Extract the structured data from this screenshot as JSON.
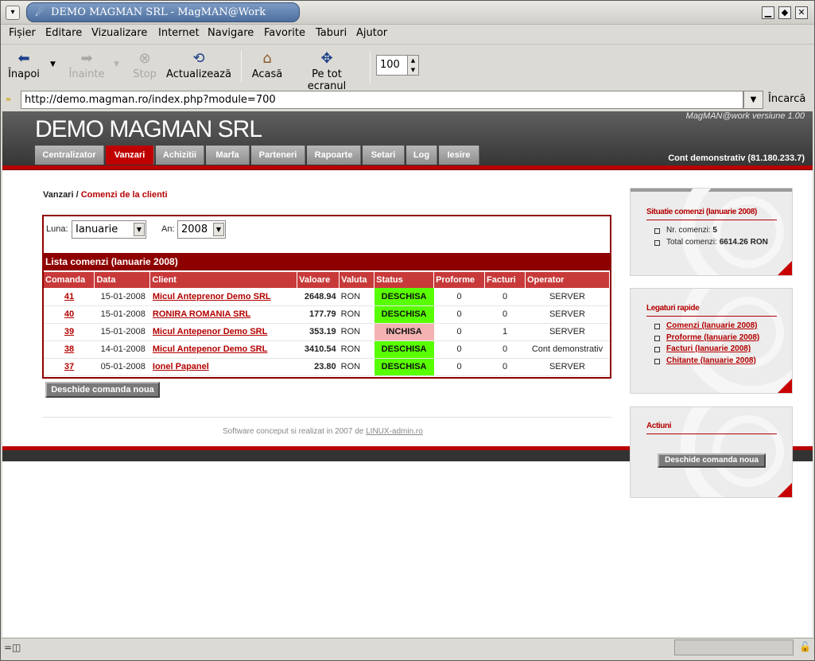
{
  "window": {
    "title": "DEMO MAGMAN SRL - MagMAN@Work",
    "controls": {
      "minimize": "▁",
      "maximize": "◆",
      "close": "✕"
    }
  },
  "menubar": [
    "Fișier",
    "Editare",
    "Vizualizare",
    "Internet",
    "Navigare",
    "Favorite",
    "Taburi",
    "Ajutor"
  ],
  "toolbar": {
    "back": "Înapoi",
    "forward": "Înainte",
    "stop": "Stop",
    "reload": "Actualizează",
    "home": "Acasă",
    "fullscreen": "Pe tot ecranul",
    "zoom": "100"
  },
  "address": {
    "url": "http://demo.magman.ro/index.php?module=700",
    "go": "Încarcă"
  },
  "site": {
    "title": "DEMO MAGMAN SRL",
    "version": "MagMAN@work versiune 1.00",
    "account": "Cont demonstrativ (81.180.233.7)",
    "nav": [
      {
        "label": "Centralizator",
        "active": false
      },
      {
        "label": "Vanzari",
        "active": true
      },
      {
        "label": "Achizitii",
        "active": false
      },
      {
        "label": "Marfa",
        "active": false
      },
      {
        "label": "Parteneri",
        "active": false
      },
      {
        "label": "Rapoarte",
        "active": false
      },
      {
        "label": "Setari",
        "active": false
      },
      {
        "label": "Log",
        "active": false
      },
      {
        "label": "Iesire",
        "active": false
      }
    ]
  },
  "breadcrumb": {
    "root": "Vanzari",
    "sep": " / ",
    "current": "Comenzi de la clienti"
  },
  "filters": {
    "month_label": "Luna:",
    "month_value": "Ianuarie",
    "year_label": "An:",
    "year_value": "2008"
  },
  "list": {
    "title": "Lista comenzi (Ianuarie 2008)",
    "columns": [
      "Comanda",
      "Data",
      "Client",
      "Valoare",
      "Valuta",
      "Status",
      "Proforme",
      "Facturi",
      "Operator"
    ],
    "rows": [
      {
        "order": "41",
        "date": "15-01-2008",
        "client": "Micul Anteprenor Demo SRL",
        "value": "2648.94",
        "currency": "RON",
        "status": "DESCHISA",
        "proforma": "0",
        "invoices": "0",
        "operator": "SERVER"
      },
      {
        "order": "40",
        "date": "15-01-2008",
        "client": "RONIRA ROMANIA SRL",
        "value": "177.79",
        "currency": "RON",
        "status": "DESCHISA",
        "proforma": "0",
        "invoices": "0",
        "operator": "SERVER"
      },
      {
        "order": "39",
        "date": "15-01-2008",
        "client": "Micul Antepenor Demo SRL",
        "value": "353.19",
        "currency": "RON",
        "status": "INCHISA",
        "proforma": "0",
        "invoices": "1",
        "operator": "SERVER"
      },
      {
        "order": "38",
        "date": "14-01-2008",
        "client": "Micul Antepenor Demo SRL",
        "value": "3410.54",
        "currency": "RON",
        "status": "DESCHISA",
        "proforma": "0",
        "invoices": "0",
        "operator": "Cont demonstrativ"
      },
      {
        "order": "37",
        "date": "05-01-2008",
        "client": "Ionel Papanel",
        "value": "23.80",
        "currency": "RON",
        "status": "DESCHISA",
        "proforma": "0",
        "invoices": "0",
        "operator": "SERVER"
      }
    ]
  },
  "new_order_button": "Deschide comanda noua",
  "footer": {
    "text": "Software conceput si realizat in 2007 de ",
    "link": "LINUX-admin.ro"
  },
  "panels": {
    "summary": {
      "title": "Situatie comenzi (Ianuarie 2008)",
      "count_label": "Nr. comenzi: ",
      "count_value": "5",
      "total_label": "Total comenzi: ",
      "total_value": "6614.26 RON"
    },
    "quick_links": {
      "title": "Legaturi rapide",
      "items": [
        "Comenzi (Ianuarie 2008)",
        "Proforme (Ianuarie 2008)",
        "Facturi (Ianuarie 2008)",
        "Chitante (Ianuarie 2008)"
      ]
    },
    "actions": {
      "title": "Actiuni",
      "button": "Deschide comanda noua"
    }
  },
  "colors": {
    "accent_red": "#b40000",
    "status_open": "#58ff00",
    "status_closed": "#f4b3b3",
    "header_dark": "#353535"
  }
}
